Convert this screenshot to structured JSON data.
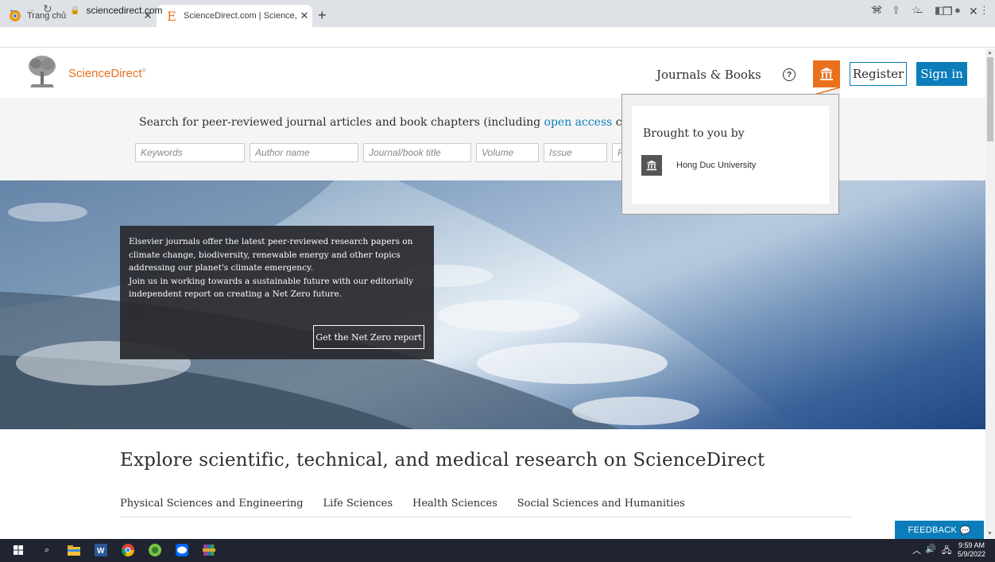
{
  "browser": {
    "tabs": [
      {
        "title": "Trang chủ",
        "icon": "chrome-favicon"
      },
      {
        "title": "ScienceDirect.com | Science, hea",
        "icon": "elsevier-favicon",
        "active": true
      }
    ],
    "new_tab": "+",
    "window_controls": [
      "﹀",
      "–",
      "❐",
      "✕"
    ],
    "url": "sciencedirect.com"
  },
  "header": {
    "brand": "ScienceDirect",
    "journals_books": "Journals & Books",
    "help": "?",
    "register": "Register",
    "sign_in": "Sign in"
  },
  "search": {
    "caption_pre": "Search for peer-reviewed journal articles and book chapters (including ",
    "caption_link": "open access",
    "caption_post": " content)",
    "fields": {
      "keywords": "Keywords",
      "author": "Author name",
      "journal": "Journal/book title",
      "volume": "Volume",
      "issue": "Issue",
      "pages": "Pages"
    }
  },
  "hero": {
    "lines": [
      "Elsevier journals offer the latest peer-reviewed research papers on",
      "climate change, biodiversity, renewable energy and other topics",
      "addressing our planet's climate emergency.",
      "Join us in working towards a sustainable future with our editorially",
      "independent report on creating a Net Zero future."
    ],
    "button": "Get the Net Zero report"
  },
  "explore": {
    "title": "Explore scientific, technical, and medical research on ScienceDirect",
    "subjects": [
      "Physical Sciences and Engineering",
      "Life Sciences",
      "Health Sciences",
      "Social Sciences and Humanities"
    ]
  },
  "popover": {
    "title": "Brought to you by",
    "institution": "Hong Duc University"
  },
  "feedback": "FEEDBACK",
  "taskbar": {
    "time": "9:59 AM",
    "date": "5/9/2022"
  },
  "colors": {
    "brand_orange": "#e9711c",
    "brand_blue": "#0c7dbb"
  }
}
